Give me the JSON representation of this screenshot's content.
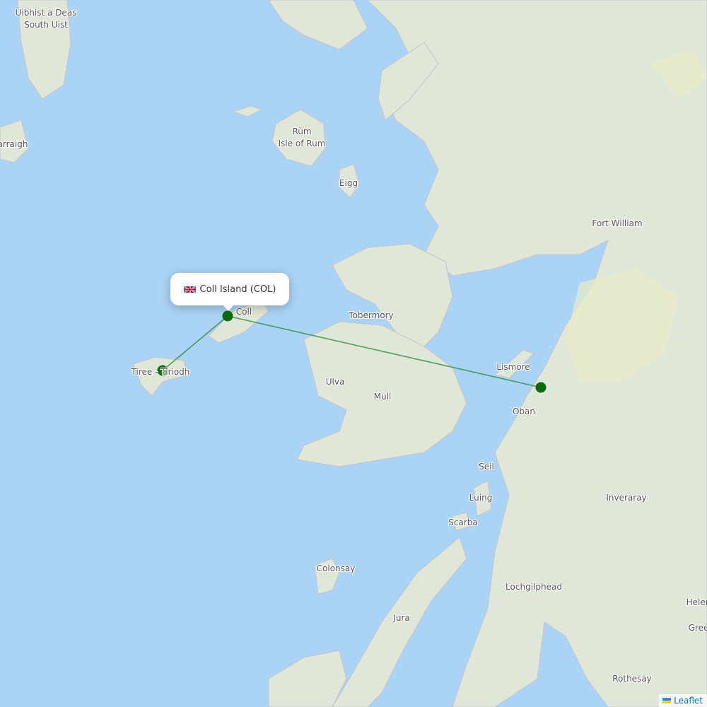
{
  "map": {
    "popup": {
      "flag_icon": "uk-flag-icon",
      "title": "Coll Island (COL)"
    },
    "airports": [
      {
        "name": "Coll Island",
        "code": "COL",
        "role": "selected"
      },
      {
        "name": "Tiree",
        "role": "destination"
      },
      {
        "name": "Oban",
        "role": "destination"
      }
    ],
    "route_color": "#2e8b3a",
    "marker_color": "#0a6b0a",
    "water_color": "#aad3f5",
    "labels": [
      {
        "id": "uibhist",
        "text": "Uibhist a Deas"
      },
      {
        "id": "south-uist",
        "text": "South Uist"
      },
      {
        "id": "barraigh",
        "text": "arraigh"
      },
      {
        "id": "rum-gaelic",
        "text": "Rùm"
      },
      {
        "id": "rum",
        "text": "Isle of Rum"
      },
      {
        "id": "eigg",
        "text": "Eigg"
      },
      {
        "id": "fort-william",
        "text": "Fort William"
      },
      {
        "id": "coll",
        "text": "Coll"
      },
      {
        "id": "tobermory",
        "text": "Tobermory"
      },
      {
        "id": "tiree",
        "text": "Tiree - Tiriodh"
      },
      {
        "id": "ulva",
        "text": "Ulva"
      },
      {
        "id": "mull",
        "text": "Mull"
      },
      {
        "id": "lismore",
        "text": "Lismore"
      },
      {
        "id": "oban",
        "text": "Oban"
      },
      {
        "id": "seil",
        "text": "Seil"
      },
      {
        "id": "luing",
        "text": "Luing"
      },
      {
        "id": "scarba",
        "text": "Scarba"
      },
      {
        "id": "inveraray",
        "text": "Inveraray"
      },
      {
        "id": "colonsay",
        "text": "Colonsay"
      },
      {
        "id": "lochgilphead",
        "text": "Lochgilphead"
      },
      {
        "id": "jura",
        "text": "Jura"
      },
      {
        "id": "helensburgh",
        "text": "Helen"
      },
      {
        "id": "greenock",
        "text": "Gree"
      },
      {
        "id": "rothesay",
        "text": "Rothesay"
      }
    ]
  },
  "attribution": {
    "flag_icon": "ukraine-flag-icon",
    "link": "Leaflet"
  }
}
